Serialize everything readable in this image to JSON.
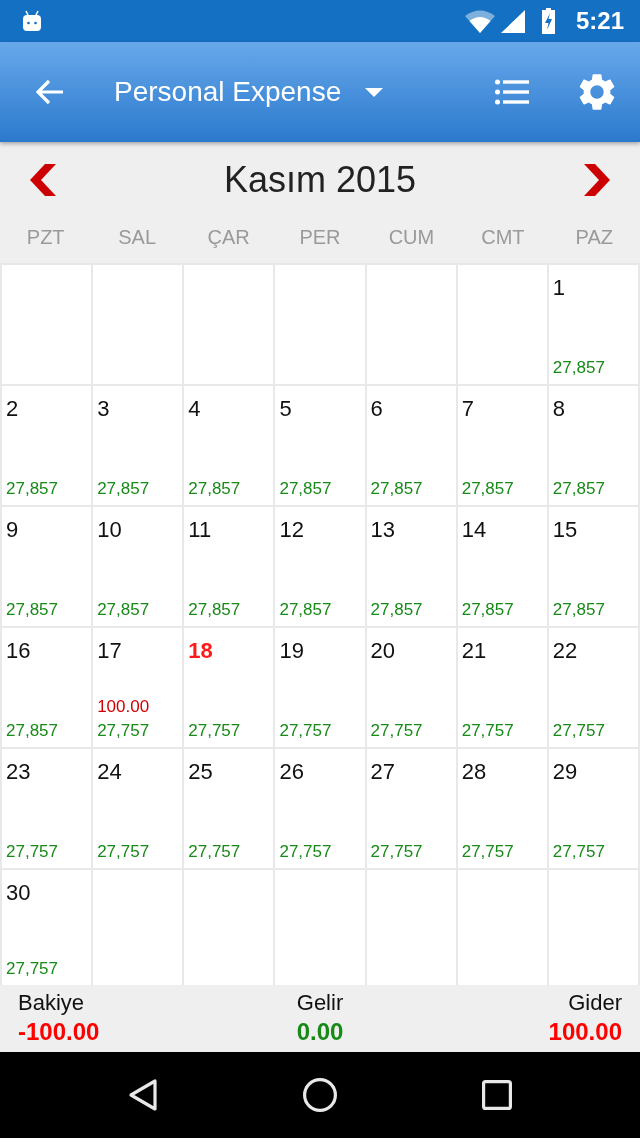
{
  "status_bar": {
    "time": "5:21"
  },
  "app_bar": {
    "title": "Personal Expense"
  },
  "calendar": {
    "month_title": "Kasım 2015",
    "weekdays": [
      "PZT",
      "SAL",
      "ÇAR",
      "PER",
      "CUM",
      "CMT",
      "PAZ"
    ],
    "weeks": [
      {
        "days": [
          {
            "kind": "blank"
          },
          {
            "kind": "blank"
          },
          {
            "kind": "blank"
          },
          {
            "kind": "blank"
          },
          {
            "kind": "blank"
          },
          {
            "kind": "blank"
          },
          {
            "kind": "day",
            "day": "1",
            "balance": "27,857",
            "today": false
          }
        ]
      },
      {
        "days": [
          {
            "kind": "day",
            "day": "2",
            "balance": "27,857",
            "today": false
          },
          {
            "kind": "day",
            "day": "3",
            "balance": "27,857",
            "today": false
          },
          {
            "kind": "day",
            "day": "4",
            "balance": "27,857",
            "today": false
          },
          {
            "kind": "day",
            "day": "5",
            "balance": "27,857",
            "today": false
          },
          {
            "kind": "day",
            "day": "6",
            "balance": "27,857",
            "today": false
          },
          {
            "kind": "day",
            "day": "7",
            "balance": "27,857",
            "today": false
          },
          {
            "kind": "day",
            "day": "8",
            "balance": "27,857",
            "today": false
          }
        ]
      },
      {
        "days": [
          {
            "kind": "day",
            "day": "9",
            "balance": "27,857",
            "today": false
          },
          {
            "kind": "day",
            "day": "10",
            "balance": "27,857",
            "today": false
          },
          {
            "kind": "day",
            "day": "11",
            "balance": "27,857",
            "today": false
          },
          {
            "kind": "day",
            "day": "12",
            "balance": "27,857",
            "today": false
          },
          {
            "kind": "day",
            "day": "13",
            "balance": "27,857",
            "today": false
          },
          {
            "kind": "day",
            "day": "14",
            "balance": "27,857",
            "today": false
          },
          {
            "kind": "day",
            "day": "15",
            "balance": "27,857",
            "today": false
          }
        ]
      },
      {
        "days": [
          {
            "kind": "day",
            "day": "16",
            "balance": "27,857",
            "today": false
          },
          {
            "kind": "day",
            "day": "17",
            "expense": "100.00",
            "balance": "27,757",
            "today": false
          },
          {
            "kind": "day",
            "day": "18",
            "balance": "27,757",
            "today": true
          },
          {
            "kind": "day",
            "day": "19",
            "balance": "27,757",
            "today": false
          },
          {
            "kind": "day",
            "day": "20",
            "balance": "27,757",
            "today": false
          },
          {
            "kind": "day",
            "day": "21",
            "balance": "27,757",
            "today": false
          },
          {
            "kind": "day",
            "day": "22",
            "balance": "27,757",
            "today": false
          }
        ]
      },
      {
        "days": [
          {
            "kind": "day",
            "day": "23",
            "balance": "27,757",
            "today": false
          },
          {
            "kind": "day",
            "day": "24",
            "balance": "27,757",
            "today": false
          },
          {
            "kind": "day",
            "day": "25",
            "balance": "27,757",
            "today": false
          },
          {
            "kind": "day",
            "day": "26",
            "balance": "27,757",
            "today": false
          },
          {
            "kind": "day",
            "day": "27",
            "balance": "27,757",
            "today": false
          },
          {
            "kind": "day",
            "day": "28",
            "balance": "27,757",
            "today": false
          },
          {
            "kind": "day",
            "day": "29",
            "balance": "27,757",
            "today": false
          }
        ]
      },
      {
        "days": [
          {
            "kind": "day",
            "day": "30",
            "balance": "27,757",
            "today": false
          },
          {
            "kind": "blank"
          },
          {
            "kind": "blank"
          },
          {
            "kind": "blank"
          },
          {
            "kind": "blank"
          },
          {
            "kind": "blank"
          },
          {
            "kind": "blank"
          }
        ]
      }
    ]
  },
  "summary": [
    {
      "label": "Bakiye",
      "value": "-100.00",
      "color": "#ff0000"
    },
    {
      "label": "Gelir",
      "value": "0.00",
      "color": "#178a17"
    },
    {
      "label": "Gider",
      "value": "100.00",
      "color": "#ff0000"
    }
  ]
}
